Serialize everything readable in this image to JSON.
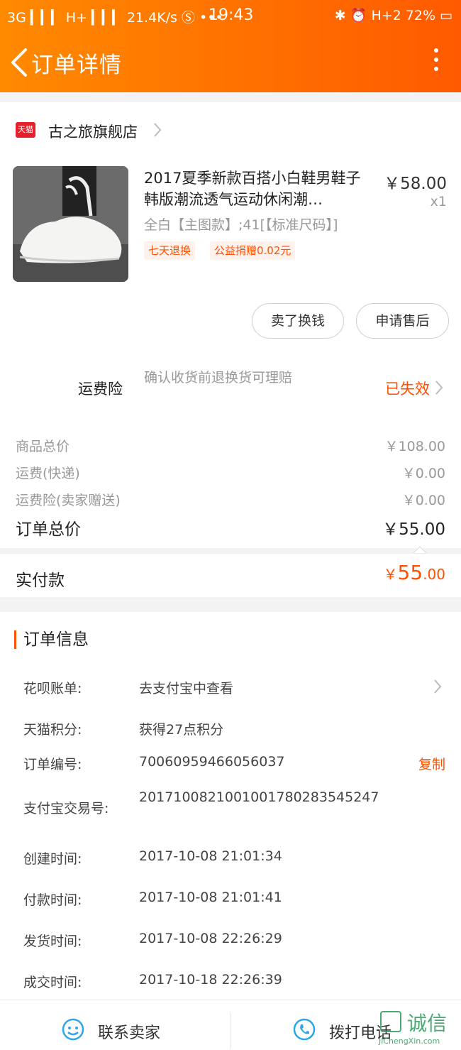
{
  "status_bar": {
    "left": "3G ▎▎▎ H+ ▎▎▎ 21.4K/s Ⓢ •••",
    "time": "19:43",
    "right": "✱ ⏰ H+2 72% ▭",
    "battery": "72%"
  },
  "header": {
    "title": "订单详情"
  },
  "shop": {
    "logo_text": "天猫",
    "name": "古之旅旗舰店"
  },
  "product": {
    "title": "2017夏季新款百搭小白鞋男鞋子韩版潮流透气运动休闲潮…",
    "price": "￥58.00",
    "qty": "x1",
    "sku": "全白【主图款】;41[【标准尺码】]",
    "tags": [
      "七天退换",
      "公益捐赠0.02元"
    ]
  },
  "actions": {
    "sell": "卖了换钱",
    "after_sale": "申请售后"
  },
  "insurance": {
    "label": "运费险",
    "desc": "确认收货前退换货可理赔",
    "status": "已失效"
  },
  "fees": [
    {
      "label": "商品总价",
      "value": "￥108.00"
    },
    {
      "label": "运费(快递)",
      "value": "￥0.00"
    },
    {
      "label": "运费险(卖家赠送)",
      "value": "￥0.00"
    }
  ],
  "order_total": {
    "label": "订单总价",
    "value": "￥55.00"
  },
  "paid": {
    "label": "实付款",
    "currency": "￥",
    "integer": "55",
    "decimal": ".00"
  },
  "order_info": {
    "title": "订单信息",
    "huabei_label": "花呗账单:",
    "huabei_value": "去支付宝中查看",
    "points_label": "天猫积分:",
    "points_value": "获得27点积分",
    "order_no_label": "订单编号:",
    "order_no_value": "70060959466056037",
    "copy_label": "复制",
    "alipay_label": "支付宝交易号:",
    "alipay_value": "2017100821001001780283545247",
    "created_label": "创建时间:",
    "created_value": "2017-10-08 21:01:34",
    "paid_label": "付款时间:",
    "paid_value": "2017-10-08 21:01:41",
    "shipped_label": "发货时间:",
    "shipped_value": "2017-10-08 22:26:29",
    "closed_label": "成交时间:",
    "closed_value": "2017-10-18 22:26:39"
  },
  "bottom_bar": {
    "contact": "联系卖家",
    "call": "拨打电话"
  },
  "watermark": {
    "main": "诚信",
    "sub": "JiChengXin.com"
  },
  "colors": {
    "accent": "#ff5000",
    "header_start": "#ff8a00",
    "header_end": "#ff5a00",
    "link_blue": "#2aa7e8"
  }
}
